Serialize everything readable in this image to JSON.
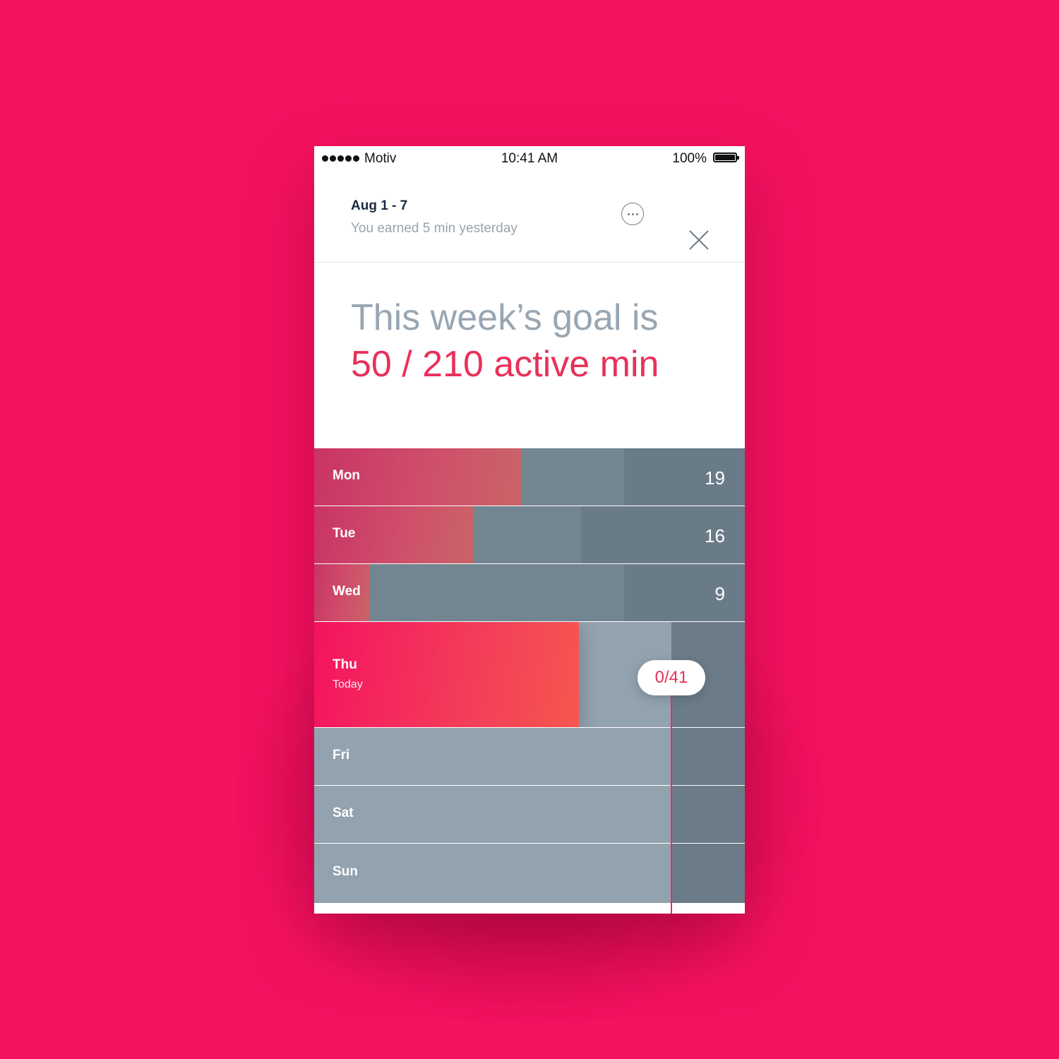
{
  "status_bar": {
    "carrier": "Motiv",
    "time": "10:41 AM",
    "battery": "100%"
  },
  "header": {
    "date_range": "Aug 1 - 7",
    "subtitle": "You earned 5 min yesterday",
    "more_icon": "ellipsis-circle-icon",
    "close_icon": "close-icon"
  },
  "goal": {
    "line1": "This week’s goal is",
    "line2": "50 / 210 active min"
  },
  "colors": {
    "background": "#f41160",
    "accent": "#e8315a",
    "track": "#92a2ae",
    "track_dark": "#6b7b88"
  },
  "days": [
    {
      "label": "Mon",
      "value": "19",
      "sublabel": "",
      "active_min": 19,
      "fill_fraction": 0.48,
      "daily_target_fraction": 0.72,
      "state": "past"
    },
    {
      "label": "Tue",
      "value": "16",
      "sublabel": "",
      "active_min": 16,
      "fill_fraction": 0.37,
      "daily_target_fraction": 0.62,
      "state": "past"
    },
    {
      "label": "Wed",
      "value": "9",
      "sublabel": "",
      "active_min": 9,
      "fill_fraction": 0.13,
      "daily_target_fraction": 0.72,
      "state": "past"
    },
    {
      "label": "Thu",
      "value": "",
      "sublabel": "Today",
      "fill_fraction": 0.615,
      "daily_target_fraction": 0.83,
      "state": "today"
    },
    {
      "label": "Fri",
      "value": "",
      "sublabel": "",
      "fill_fraction": 0,
      "daily_target_fraction": 0.83,
      "state": "future"
    },
    {
      "label": "Sat",
      "value": "",
      "sublabel": "",
      "fill_fraction": 0,
      "daily_target_fraction": 0.83,
      "state": "future"
    },
    {
      "label": "Sun",
      "value": "",
      "sublabel": "",
      "fill_fraction": 0,
      "daily_target_fraction": 0.83,
      "state": "future"
    }
  ],
  "today_badge": "0/41"
}
